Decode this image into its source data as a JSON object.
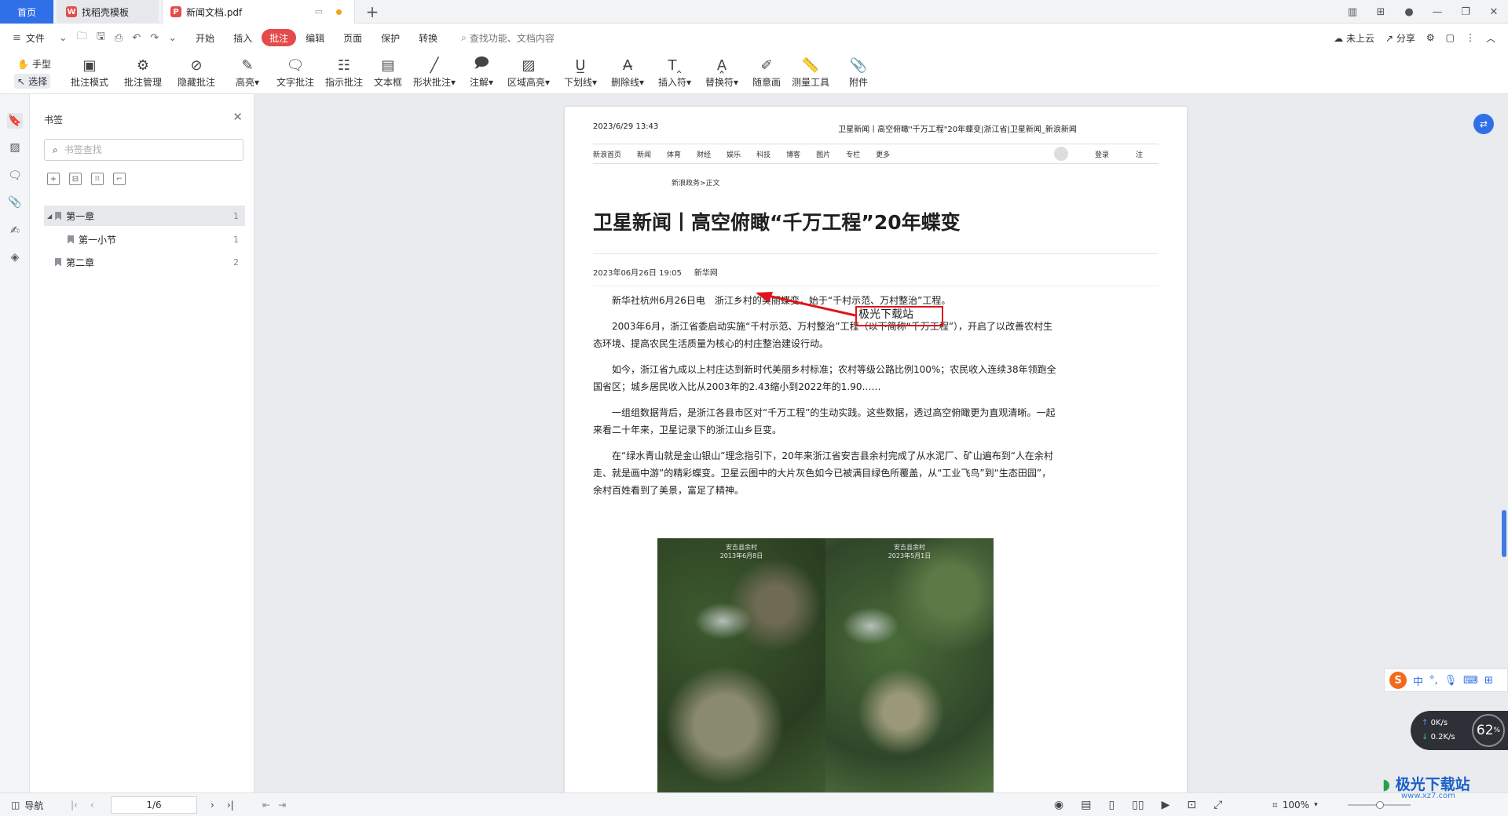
{
  "tabs": {
    "home": "首页",
    "template": "找稻壳模板",
    "document": "新闻文档.pdf",
    "add": "+"
  },
  "menu": {
    "file": "文件",
    "items": [
      "开始",
      "插入",
      "批注",
      "编辑",
      "页面",
      "保护",
      "转换"
    ],
    "active": "批注",
    "search": "查找功能、文档内容",
    "cloud": "未上云",
    "share": "分享"
  },
  "ribbon": {
    "hand": "手型",
    "select": "选择",
    "buttons": [
      "批注模式",
      "批注管理",
      "隐藏批注",
      "高亮",
      "文字批注",
      "指示批注",
      "文本框",
      "形状批注",
      "注解",
      "区域高亮",
      "下划线",
      "删除线",
      "插入符",
      "替换符",
      "随意画",
      "测量工具",
      "附件"
    ]
  },
  "bookmarks": {
    "title": "书签",
    "search_placeholder": "书签查找",
    "items": [
      {
        "label": "第一章",
        "page": "1"
      },
      {
        "label": "第一小节",
        "page": "1"
      },
      {
        "label": "第二章",
        "page": "2"
      }
    ]
  },
  "document_page": {
    "header_left": "2023/6/29 13:43",
    "header_right": "卫星新闻丨高空俯瞰\"千万工程\"20年蝶变|浙江省|卫星新闻_新浪新闻",
    "nav": [
      "新浪首页",
      "新闻",
      "体育",
      "财经",
      "娱乐",
      "科技",
      "博客",
      "图片",
      "专栏",
      "更多"
    ],
    "nav_login": "登录",
    "nav_register": "注",
    "breadcrumb": "新浪政务>正文",
    "title": "卫星新闻丨高空俯瞰“千万工程”20年蝶变",
    "date": "2023年06月26日 19:05",
    "source": "新华网",
    "paragraphs": [
      "新华社杭州6月26日电　浙江乡村的美丽蝶变，始于“千村示范、万村整治”工程。",
      "2003年6月，浙江省委启动实施“千村示范、万村整治”工程（以下简称“千万工程”），开启了以改善农村生态环境、提高农民生活质量为核心的村庄整治建设行动。",
      "如今，浙江省九成以上村庄达到新时代美丽乡村标准；农村等级公路比例100%；农民收入连续38年领跑全国省区；城乡居民收入比从2003年的2.43缩小到2022年的1.90……",
      "一组组数据背后，是浙江各县市区对“千万工程”的生动实践。这些数据，透过高空俯瞰更为直观清晰。一起来看二十年来，卫星记录下的浙江山乡巨变。",
      "在“绿水青山就是金山银山”理念指引下，20年来浙江省安吉县余村完成了从水泥厂、矿山遍布到“人在余村走、就是画中游”的精彩蝶变。卫星云图中的大片灰色如今已被满目绿色所覆盖，从“工业飞鸟”到“生态田园”，余村百姓看到了美景，富足了精神。"
    ],
    "image_caption_left": "安吉县余村\n2013年6月8日",
    "image_caption_right": "安吉县余村\n2023年5月1日",
    "annotation_text": "极光下载站"
  },
  "statusbar": {
    "nav": "导航",
    "page": "1/6",
    "zoom": "100%"
  },
  "overlays": {
    "ime_lang": "中",
    "net_up": "0K/s",
    "net_down": "0.2K/s",
    "net_pct": "62",
    "watermark": "极光下载站",
    "watermark_url": "www.xz7.com"
  },
  "colors": {
    "accent": "#2f6fe8",
    "active_tab": "#e54b4b",
    "annotation": "#e0141b"
  }
}
